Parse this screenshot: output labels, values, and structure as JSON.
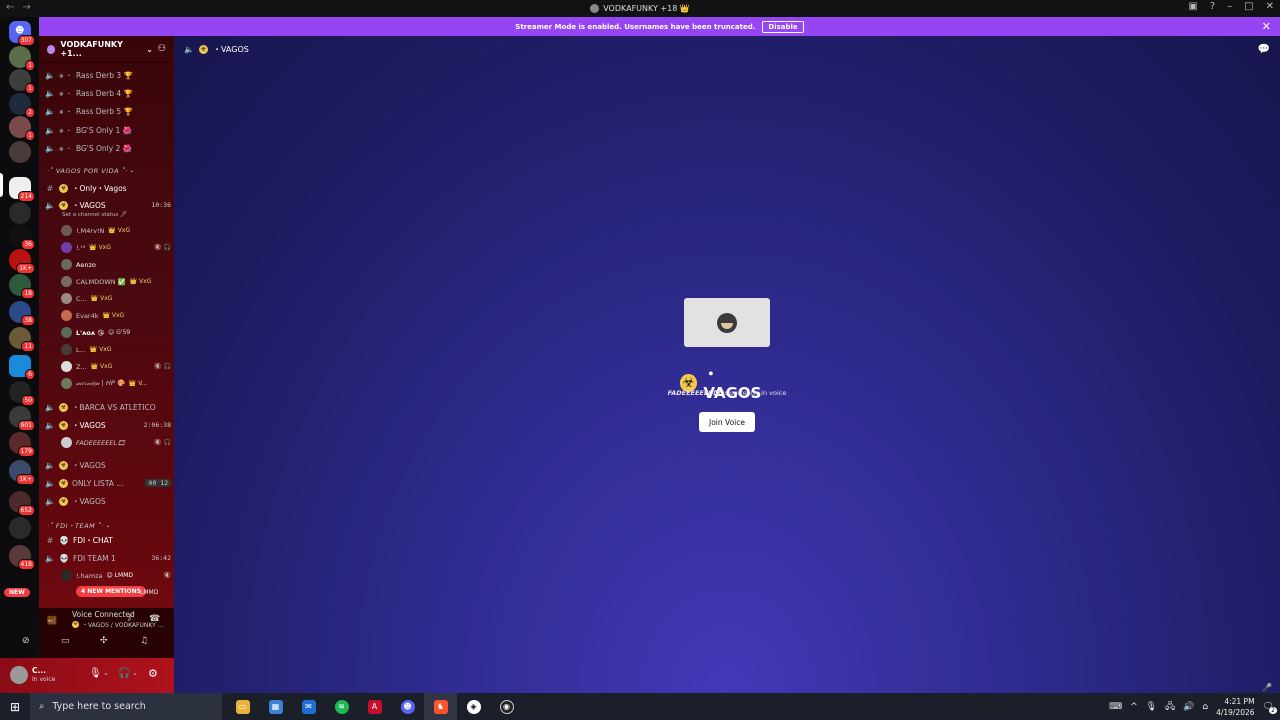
{
  "window": {
    "title": "VODKAFUNKY +18 👑"
  },
  "banner": {
    "text": "Streamer Mode is enabled. Usernames have been truncated.",
    "button": "Disable"
  },
  "guild_badges": [
    "307",
    "1",
    "1",
    "2",
    "1",
    "214",
    "36",
    "1K+",
    "18",
    "38",
    "11",
    "6",
    "50",
    "901",
    "179",
    "1K+",
    "652",
    "418"
  ],
  "new_badge": "NEW",
  "server": {
    "name": "VODKAFUNKY +1...",
    "channel": "VAGOS"
  },
  "channels_top": [
    {
      "name": "Rass Derb 3 🏆"
    },
    {
      "name": "Rass Derb 4 🏆"
    },
    {
      "name": "Rass Derb 5 🏆"
    },
    {
      "name": "BG'S Only 1 🌺"
    },
    {
      "name": "BG'S Only 2 🌺"
    }
  ],
  "category_vagos": "·˚ VAGOS POR VIDA ˚· ˖",
  "ch_only_vagos": "・Only・Vagos",
  "ch_vagos_main": {
    "name": "・VAGOS",
    "time": "10:36",
    "status": "Set a channel status 🖊"
  },
  "voice_users_1": [
    {
      "name": "!.M4rv!N",
      "tag": "👑 VxG",
      "icons": ""
    },
    {
      "name": "!.ᵗ⁹",
      "tag": "👑 VxG",
      "icons": "🔇 🎧"
    },
    {
      "name": "Aenzo",
      "tag": "",
      "icons": ""
    },
    {
      "name": "CALMDOWN ✅",
      "tag": "👑 VxG",
      "icons": ""
    },
    {
      "name": "C...",
      "tag": "👑 VxG",
      "icons": ""
    },
    {
      "name": "Evar4k",
      "tag": "👑 VxG",
      "icons": ""
    },
    {
      "name": "L'ᴀᴏᴀ 😘",
      "tag": "☺ G'59",
      "icons": ""
    },
    {
      "name": "L...",
      "tag": "👑 VxG",
      "icons": ""
    },
    {
      "name": "Z...",
      "tag": "👑 VxG",
      "icons": "🔇 🎧"
    },
    {
      "name": "𝓂𝑒𝓇𝓃𝒾𝑔𝒶 | HP 🎨",
      "tag": "👑 V...",
      "icons": ""
    }
  ],
  "ch_barca": "・BARCA VS ATLETICO",
  "ch_vagos2": {
    "name": "・VAGOS",
    "time": "2:06:38"
  },
  "voice_users_2": [
    {
      "name": "FADEEEEEEL🎞",
      "icons": "🔇 🎧"
    }
  ],
  "ch_vagos3": "・VAGOS",
  "ch_only_lista": {
    "name": "ONLY LISTA ...",
    "a": "00",
    "b": "12"
  },
  "ch_vagos4": "・VAGOS",
  "category_fdi": "·˚ FDI・TEAM ˚· ˖",
  "ch_fdi_chat": "FDI・CHAT",
  "ch_fdi_team": {
    "name": "FDI TEAM 1",
    "time": "36:42"
  },
  "voice_users_3": [
    {
      "name": "!.hamza",
      "tag": "😊 LMMD",
      "icons": "🔇"
    }
  ],
  "mentions": "4 NEW MENTIONS",
  "mentions_tag": "LMMD",
  "voice_panel": {
    "title": "Voice Connected",
    "sub": "・VAGOS / VODKAFUNKY ..."
  },
  "user_panel": {
    "name": "C...",
    "status": "In voice"
  },
  "main": {
    "title": "VAGOS",
    "sub_user": "FADEEEEEEL🎞",
    "sub_text": " is currently in voice",
    "join": "Join Voice"
  },
  "taskbar": {
    "search_placeholder": "Type here to search",
    "time": "4:21 PM",
    "date": "4/19/2026",
    "notif": "2"
  }
}
